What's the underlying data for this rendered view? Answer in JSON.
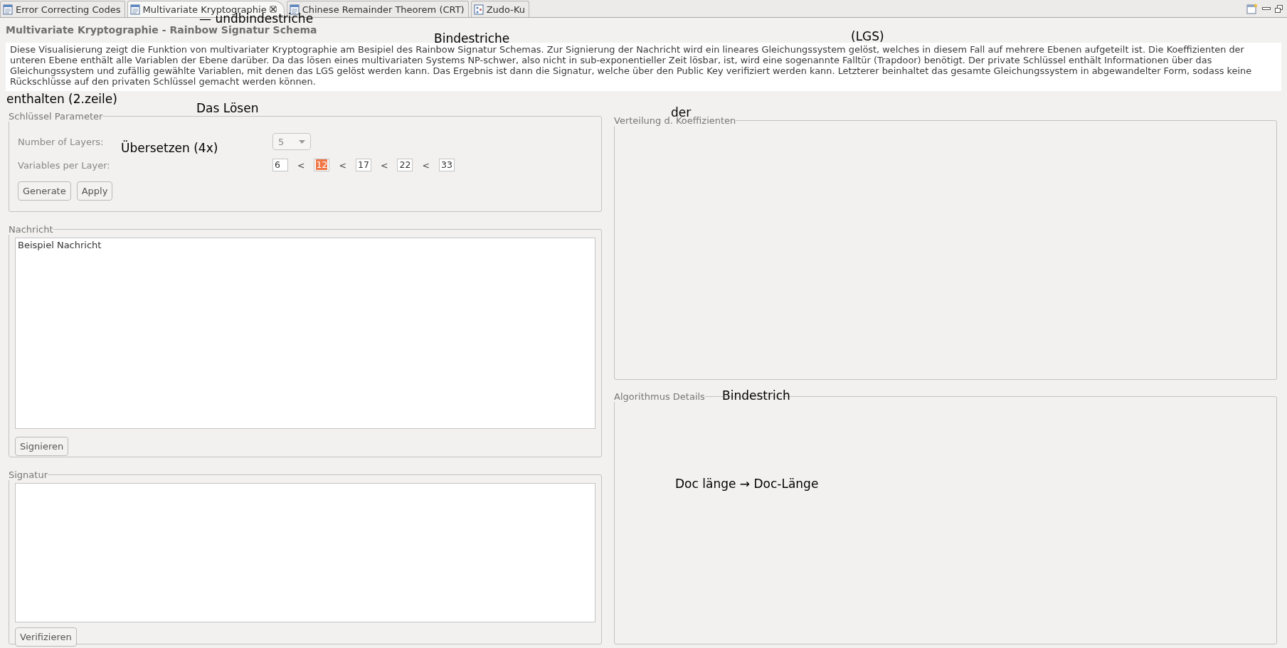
{
  "tabs": [
    {
      "label": "Error Correcting Codes",
      "selected": false,
      "kind": "document"
    },
    {
      "label": "Multivariate Kryptographie",
      "selected": true,
      "kind": "document"
    },
    {
      "label": "Chinese Remainder Theorem (CRT)",
      "selected": false,
      "kind": "document"
    },
    {
      "label": "Zudo-Ku",
      "selected": false,
      "kind": "grid"
    }
  ],
  "title": "Multivariate Kryptographie - Rainbow Signatur Schema",
  "description": "Diese Visualisierung zeigt die Funktion von multivariater Kryptographie am Besipiel des Rainbow Signatur Schemas. Zur Signierung der Nachricht wird ein lineares Gleichungssystem gelöst, welches in diesem Fall auf mehrere Ebenen aufgeteilt ist. Die Koeffizienten der unteren Ebene enthält alle Variablen der Ebene darüber. Da das lösen eines multivariaten Systems NP-schwer, also nicht in sub-exponentieller Zeit lösbar, ist, wird eine sogenannte Falltür (Trapdoor) benötigt. Der private Schlüssel enthält Informationen über das Gleichungssystem und zufällig gewählte Variablen, mit denen das LGS gelöst werden kann. Das Ergebnis ist dann die Signatur, welche über den Public Key verifiziert werden kann. Letzterer beinhaltet das gesamte Gleichungssystem in abgewandelter Form, sodass keine Rückschlüsse auf den privaten Schlüssel gemacht werden können.",
  "key_parameters": {
    "title": "Schlüssel Parameter",
    "layers_label": "Number of Layers:",
    "layers_value": "5",
    "layers_disabled": true,
    "variables_label": "Variables per Layer:",
    "variables": [
      {
        "value": "6",
        "selected": false
      },
      {
        "value": "12",
        "selected": true
      },
      {
        "value": "17",
        "selected": false
      },
      {
        "value": "22",
        "selected": false
      },
      {
        "value": "33",
        "selected": false
      }
    ],
    "separators": [
      "<",
      "<",
      "<",
      "<"
    ],
    "buttons": [
      "Generate",
      "Apply"
    ]
  },
  "message": {
    "title": "Nachricht",
    "text": "Beispiel Nachricht",
    "button": "Signieren"
  },
  "signature": {
    "title": "Signatur",
    "button": "Verifizieren"
  },
  "coefficient_distribution": {
    "title": "Verteilung d. Koeffizienten"
  },
  "algorithm_details": {
    "title": "Algorithmus Details"
  },
  "annotations": [
    {
      "text": "— undbindestriche"
    },
    {
      "text": "Bindestriche"
    },
    {
      "text": "(LGS)"
    },
    {
      "text": "enthalten  (2.zeile)"
    },
    {
      "text": "Das Lösen"
    },
    {
      "text": "Übersetzen (4x)"
    },
    {
      "text": "der"
    },
    {
      "text": "Bindestrich"
    },
    {
      "text": "Doc länge → Doc-Länge"
    }
  ]
}
